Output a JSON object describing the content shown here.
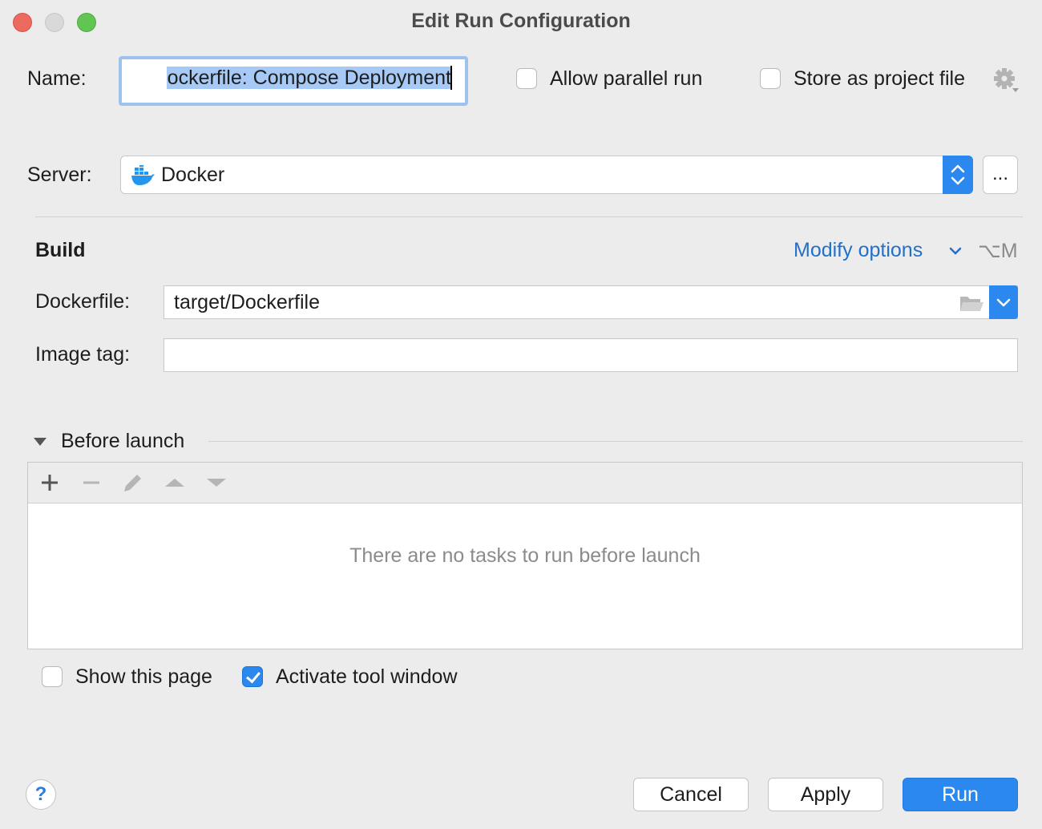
{
  "window": {
    "title": "Edit Run Configuration"
  },
  "form": {
    "name_label": "Name:",
    "name_value": "ockerfile: Compose Deployment",
    "allow_parallel_label": "Allow parallel run",
    "allow_parallel_checked": false,
    "store_project_label": "Store as project file",
    "store_project_checked": false,
    "server_label": "Server:",
    "server_value": "Docker",
    "server_more_label": "..."
  },
  "build": {
    "heading": "Build",
    "modify_options_label": "Modify options",
    "modify_shortcut": "⌥M",
    "dockerfile_label": "Dockerfile:",
    "dockerfile_value": "target/Dockerfile",
    "image_tag_label": "Image tag:",
    "image_tag_value": ""
  },
  "before_launch": {
    "heading": "Before launch",
    "empty_text": "There are no tasks to run before launch",
    "show_page_label": "Show this page",
    "show_page_checked": false,
    "activate_tool_label": "Activate tool window",
    "activate_tool_checked": true
  },
  "footer": {
    "help_label": "?",
    "cancel_label": "Cancel",
    "apply_label": "Apply",
    "run_label": "Run"
  },
  "colors": {
    "accent": "#2a88ef",
    "link": "#2470c7",
    "selection": "#a6c9f6",
    "close": "#ed6a5e",
    "maximize": "#61c554"
  }
}
